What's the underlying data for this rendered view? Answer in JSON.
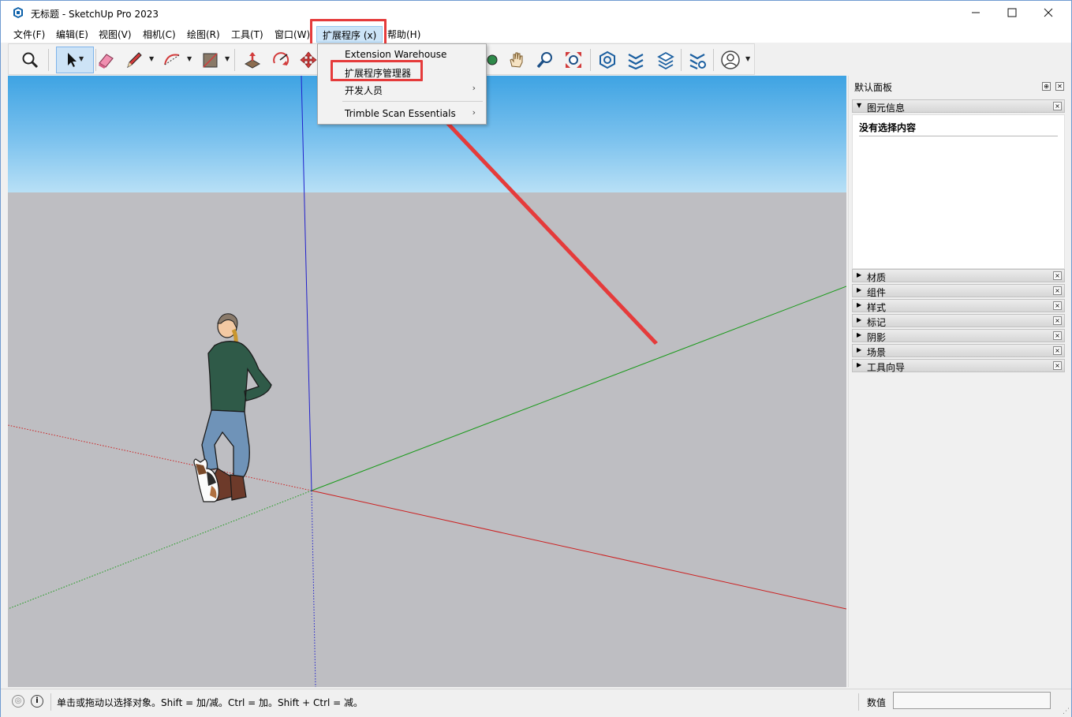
{
  "window": {
    "title": "无标题 - SketchUp Pro 2023",
    "minimize": "—",
    "maximize": "☐",
    "close": "✕"
  },
  "menubar": {
    "items": [
      "文件(F)",
      "编辑(E)",
      "视图(V)",
      "相机(C)",
      "绘图(R)",
      "工具(T)",
      "窗口(W)",
      "扩展程序 (x)",
      "帮助(H)"
    ],
    "active": "扩展程序 (x)"
  },
  "dropdown": {
    "items": [
      {
        "label": "Extension Warehouse",
        "submenu": false
      },
      {
        "label": "扩展程序管理器",
        "submenu": false,
        "highlighted": true
      },
      {
        "label": "开发人员",
        "submenu": true
      },
      {
        "label": "Trimble Scan Essentials",
        "submenu": true
      }
    ],
    "arrow": "›"
  },
  "toolbar": {
    "tools": [
      "zoom-icon",
      "select-icon",
      "eraser-icon",
      "pencil-icon",
      "arc-icon",
      "shape-icon",
      "push-pull-icon",
      "rotate-icon",
      "move-icon",
      "orbit-icon",
      "pan-icon",
      "zoom-window-icon",
      "zoom-extents-icon",
      "warehouse-icon",
      "extension-warehouse-icon",
      "layout-icon",
      "extension-manager-icon",
      "account-icon"
    ]
  },
  "panel": {
    "title": "默认面板",
    "pin": "⊕",
    "close": "✕",
    "entity_info": {
      "label": "图元信息",
      "body_text": "没有选择内容"
    },
    "trays": [
      "材质",
      "组件",
      "样式",
      "标记",
      "阴影",
      "场景",
      "工具向导"
    ],
    "collapsed_marker": "▶",
    "expanded_marker": "▼",
    "tray_close": "×"
  },
  "status": {
    "geo_icon": "◎",
    "info_icon": "i",
    "text": "单击或拖动以选择对象。Shift = 加/减。Ctrl = 加。Shift + Ctrl = 减。",
    "measurements_label": "数值",
    "measurements_value": ""
  },
  "colors": {
    "highlight_red": "#e53b3b",
    "axis_red": "#cc2020",
    "axis_green": "#1a9a1a",
    "axis_blue": "#2020cc",
    "sky_top": "#3ea3e3",
    "ground": "#bebec2"
  }
}
